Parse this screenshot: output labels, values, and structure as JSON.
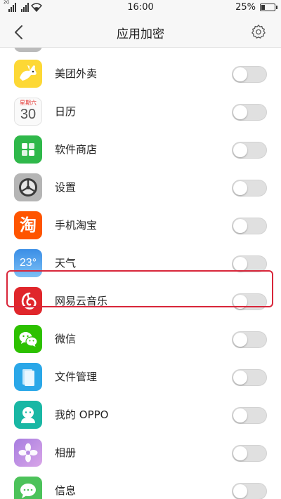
{
  "status_bar": {
    "network_tag": "2G",
    "time": "16:00",
    "battery_text": "25%",
    "battery_level": 0.25
  },
  "header": {
    "title": "应用加密"
  },
  "calendar": {
    "weekday": "星期六",
    "day": "30"
  },
  "weather": {
    "temp": "23°"
  },
  "apps": [
    {
      "label": "美团外卖",
      "icon": "meituan-kangaroo-icon",
      "locked": false
    },
    {
      "label": "日历",
      "icon": "calendar-icon",
      "locked": false
    },
    {
      "label": "软件商店",
      "icon": "app-store-icon",
      "locked": false
    },
    {
      "label": "设置",
      "icon": "settings-app-icon",
      "locked": false
    },
    {
      "label": "手机淘宝",
      "icon": "taobao-icon",
      "locked": false
    },
    {
      "label": "天气",
      "icon": "weather-icon",
      "locked": false
    },
    {
      "label": "网易云音乐",
      "icon": "netease-music-icon",
      "locked": false
    },
    {
      "label": "微信",
      "icon": "wechat-icon",
      "locked": false
    },
    {
      "label": "文件管理",
      "icon": "file-manager-icon",
      "locked": false
    },
    {
      "label": "我的 OPPO",
      "icon": "my-oppo-icon",
      "locked": false
    },
    {
      "label": "相册",
      "icon": "gallery-icon",
      "locked": false
    },
    {
      "label": "信息",
      "icon": "messages-icon",
      "locked": false
    }
  ],
  "colors": {
    "highlight": "#d8263a",
    "toggle_off": "#e0e0e0",
    "wechat": "#2dc100",
    "taobao": "#ff5500"
  }
}
